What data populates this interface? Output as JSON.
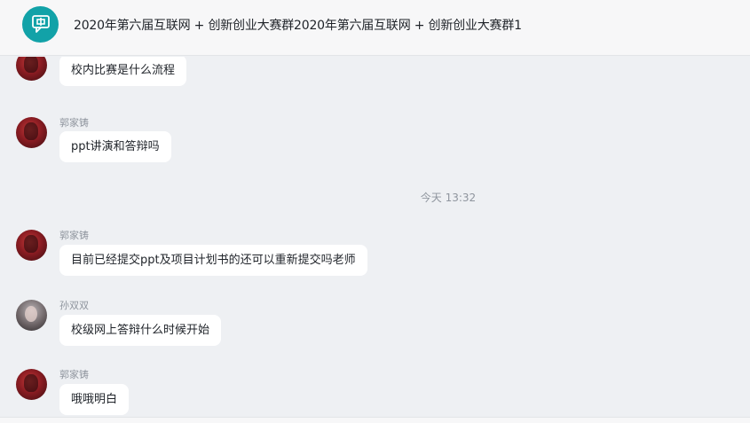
{
  "header": {
    "title": "2020年第六届互联网 + 创新创业大赛群2020年第六届互联网 + 创新创业大赛群1",
    "avatar_icon": "chat-group-icon",
    "accent": "#12a2a8"
  },
  "messages": [
    {
      "sender": "",
      "text": "校内比赛是什么流程",
      "avatar": "red-portrait"
    },
    {
      "sender": "郭家铸",
      "text": "ppt讲演和答辩吗",
      "avatar": "red-portrait"
    },
    {
      "sender": "郭家铸",
      "text": "目前已经提交ppt及项目计划书的还可以重新提交吗老师",
      "avatar": "red-portrait"
    },
    {
      "sender": "孙双双",
      "text": "校级网上答辩什么时候开始",
      "avatar": "gray-portrait"
    },
    {
      "sender": "郭家铸",
      "text": "哦哦明白",
      "avatar": "red-portrait"
    }
  ],
  "timestamp": "今天 13:32"
}
